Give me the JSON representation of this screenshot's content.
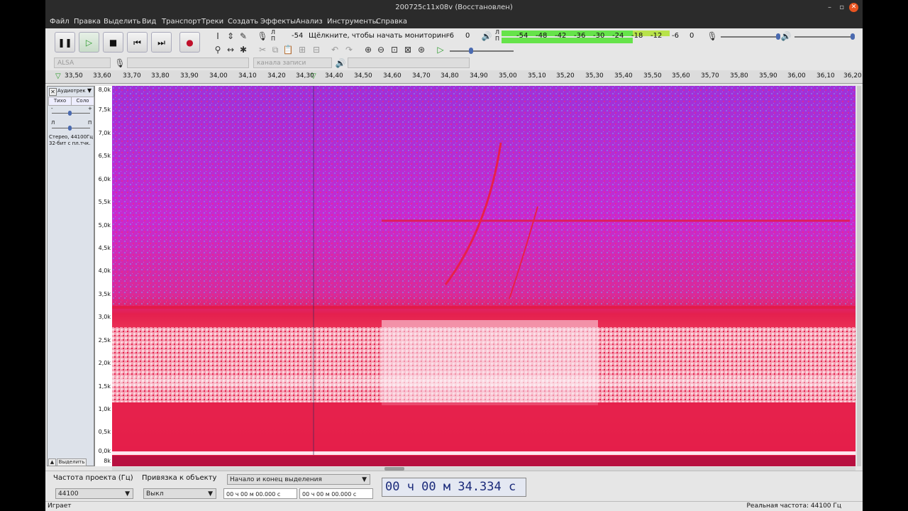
{
  "window": {
    "title": "200725c11x08v (Восстановлен)"
  },
  "menu": [
    "Файл",
    "Правка",
    "Выделить",
    "Вид",
    "Транспорт",
    "Треки",
    "Создать",
    "Эффекты",
    "Анализ",
    "Инструменты",
    "Справка"
  ],
  "rec_meter": {
    "l": "Л",
    "r": "П",
    "scale_start": "-54",
    "prompt": "Щёлкните, чтобы начать мониторинг",
    "m6": "-6",
    "zero": "0"
  },
  "play_meter": {
    "l": "Л",
    "r": "П",
    "scale": [
      "-54",
      "-48",
      "-42",
      "-36",
      "-30",
      "-24",
      "-18",
      "-12",
      "-6",
      "0"
    ]
  },
  "devices": {
    "host": "ALSA",
    "channels": "канала записи (стерео)"
  },
  "ruler": {
    "ticks": [
      "33,50",
      "33,60",
      "33,70",
      "33,80",
      "33,90",
      "34,00",
      "34,10",
      "34,20",
      "34,30",
      "34,40",
      "34,50",
      "34,60",
      "34,70",
      "34,80",
      "34,90",
      "35,00",
      "35,10",
      "35,20",
      "35,30",
      "35,40",
      "35,50",
      "35,60",
      "35,70",
      "35,80",
      "35,90",
      "36,00",
      "36,10",
      "36,20"
    ]
  },
  "track": {
    "name": "Аудиотрек",
    "mute": "Тихо",
    "solo": "Соло",
    "minus": "-",
    "plus": "+",
    "left": "Л",
    "right": "П",
    "info1": "Стерео, 44100Гц",
    "info2": "32-бит с пл.тчк.",
    "select": "Выделить"
  },
  "yaxis": {
    "labels": [
      "8,0k",
      "7,5k",
      "7,0k",
      "6,5k",
      "6,0k",
      "5,5k",
      "5,0k",
      "4,5k",
      "4,0k",
      "3,5k",
      "3,0k",
      "2,5k",
      "2,0k",
      "1,5k",
      "1,0k",
      "0,5k",
      "0,0k"
    ],
    "bottom": "8k"
  },
  "selection": {
    "rate_label": "Частота проекта (Гц)",
    "snap_label": "Привязка к объекту",
    "mode": "Начало и конец выделения",
    "rate": "44100",
    "snap": "Выкл",
    "start": "00 ч 00 м 00.000 с",
    "end": "00 ч 00 м 00.000 с"
  },
  "time": {
    "display": "00 ч 00 м 34.334 с"
  },
  "status": {
    "left": "Играет",
    "right": "Реальная частота: 44100 Гц"
  },
  "colors": {
    "spec_bg": "#c41cc4",
    "band": "#e8204a",
    "hot": "#ffe0ee",
    "green_meter": "#66e34a"
  }
}
